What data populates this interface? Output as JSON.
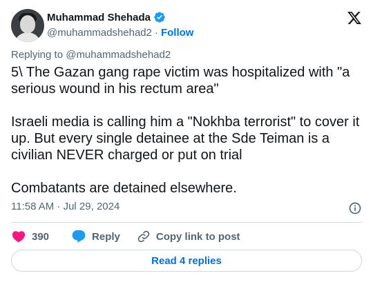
{
  "author": {
    "display_name": "Muhammad Shehada",
    "handle": "@muhammadshehad2",
    "separator": "·",
    "follow_label": "Follow",
    "verified": true
  },
  "reply_context": "Replying to @muhammadshehad2",
  "tweet": {
    "text": "5\\ The Gazan gang rape victim was hospitalized with \"a serious wound in his rectum area\"\n\nIsraeli media is calling him a \"Nokhba terrorist\" to cover it up. But every single detainee at the Sde Teiman is a civilian NEVER charged or put on trial\n\nCombatants are detained elsewhere.",
    "timestamp": "11:58 AM · Jul 29, 2024"
  },
  "actions": {
    "like_count": "390",
    "reply_label": "Reply",
    "copy_link_label": "Copy link to post"
  },
  "read_replies_label": "Read 4 replies",
  "colors": {
    "accent": "#006fd6",
    "like": "#f91880",
    "reply_bubble": "#1d9bf0",
    "muted": "#536471",
    "border": "#cfd9de"
  },
  "icons": [
    "x-logo-icon",
    "verified-badge-icon",
    "info-icon",
    "heart-icon",
    "reply-bubble-icon",
    "link-icon"
  ]
}
